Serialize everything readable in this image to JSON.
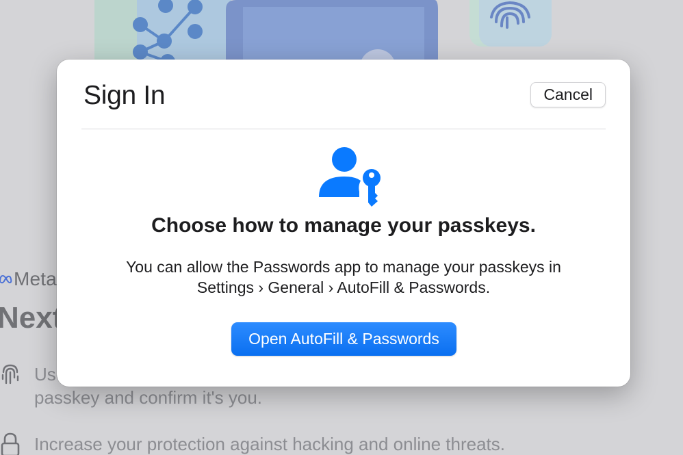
{
  "background_page": {
    "brand": "Meta",
    "heading": "Next",
    "rows": [
      {
        "icon": "fingerprint-icon",
        "text": "Use",
        "text_line2": "passkey and confirm it's you."
      },
      {
        "icon": "lock-icon",
        "text": "Increase your protection against hacking and online threats."
      }
    ]
  },
  "dialog": {
    "title": "Sign In",
    "cancel_label": "Cancel",
    "icon": "person-key-icon",
    "heading": "Choose how to manage your passkeys.",
    "body_line1": "You can allow the Passwords app to manage your passkeys in",
    "body_line2": "Settings › General › AutoFill & Passwords.",
    "primary_button_label": "Open AutoFill & Passwords"
  },
  "colors": {
    "accent": "#0a7aff",
    "dialog_background": "#ffffff",
    "dimmed_background": "#d4d4d7"
  }
}
